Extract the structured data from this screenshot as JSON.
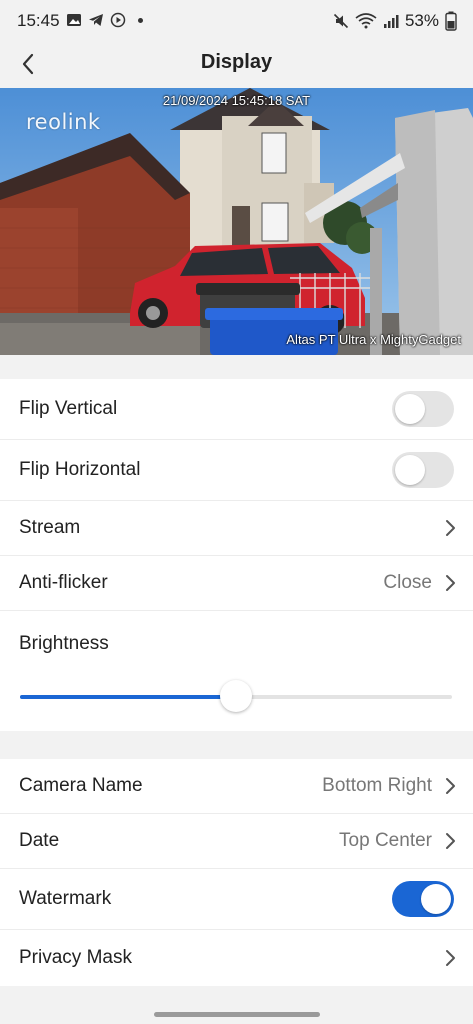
{
  "status_bar": {
    "time": "15:45",
    "battery": "53%",
    "left_icons": [
      "gallery-icon",
      "telegram-icon",
      "play-icon"
    ],
    "right_icons": [
      "mute-icon",
      "wifi-icon",
      "signal-icon"
    ]
  },
  "header": {
    "title": "Display"
  },
  "preview": {
    "logo": "reolink",
    "date_overlay": "21/09/2024 15:45:18 SAT",
    "name_overlay": "Altas PT Ultra x MightyGadget"
  },
  "settings": {
    "flip_vertical": {
      "label": "Flip Vertical",
      "on": false
    },
    "flip_horizontal": {
      "label": "Flip Horizontal",
      "on": false
    },
    "stream": {
      "label": "Stream"
    },
    "anti_flicker": {
      "label": "Anti-flicker",
      "value": "Close"
    },
    "brightness": {
      "label": "Brightness",
      "level": 0.5
    }
  },
  "osd": {
    "camera_name": {
      "label": "Camera Name",
      "value": "Bottom Right"
    },
    "date": {
      "label": "Date",
      "value": "Top Center"
    },
    "watermark": {
      "label": "Watermark",
      "on": true
    },
    "privacy_mask": {
      "label": "Privacy Mask"
    }
  },
  "colors": {
    "accent": "#1a66d4",
    "background": "#f2f2f2",
    "toggle_off": "#e4e4e4"
  }
}
